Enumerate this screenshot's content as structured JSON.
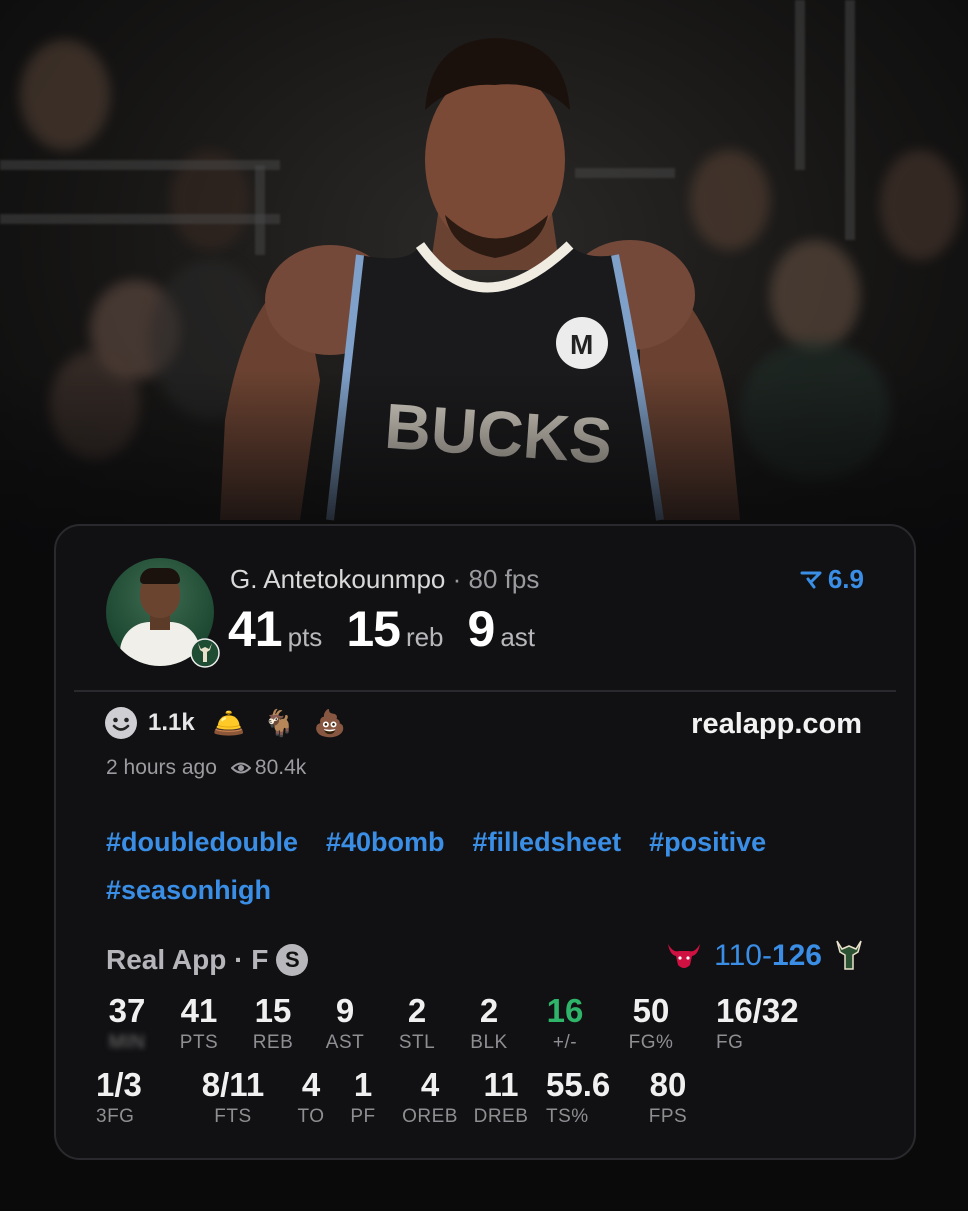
{
  "card": {
    "player_name": "G. Antetokounmpo",
    "fps_label": "80 fps",
    "pts": "41",
    "pts_unit": "pts",
    "reb": "15",
    "reb_unit": "reb",
    "ast": "9",
    "ast_unit": "ast",
    "rating": "6.9",
    "reaction_count": "1.1k",
    "reactions": [
      "🛎️",
      "🐐",
      "💩"
    ],
    "site": "realapp.com",
    "time_ago": "2 hours ago",
    "views": "80.4k",
    "hashtags": [
      "#doubledouble",
      "#40bomb",
      "#filledsheet",
      "#positive",
      "#seasonhigh"
    ],
    "source_label": "Real App · F",
    "source_badge": "S",
    "score_away": "110",
    "score_sep": "-",
    "score_home": "126"
  },
  "stats": [
    {
      "value": "37",
      "key": "MIN"
    },
    {
      "value": "41",
      "key": "PTS"
    },
    {
      "value": "15",
      "key": "REB"
    },
    {
      "value": "9",
      "key": "AST"
    },
    {
      "value": "2",
      "key": "STL"
    },
    {
      "value": "2",
      "key": "BLK"
    },
    {
      "value": "16",
      "key": "+/-"
    },
    {
      "value": "50",
      "key": "FG%"
    },
    {
      "value": "16/32",
      "key": "FG"
    },
    {
      "value": "1/3",
      "key": "3FG"
    },
    {
      "value": "8/11",
      "key": "FTS"
    },
    {
      "value": "4",
      "key": "TO"
    },
    {
      "value": "1",
      "key": "PF"
    },
    {
      "value": "4",
      "key": "OREB"
    },
    {
      "value": "11",
      "key": "DREB"
    },
    {
      "value": "55.6",
      "key": "TS%"
    },
    {
      "value": "80",
      "key": "FPS"
    }
  ],
  "colors": {
    "accent": "#3a8ee6",
    "positive": "#2fb56a",
    "card_bg": "#111113",
    "jersey": "#1a1a1c"
  },
  "icons": {
    "rating": "ticket-arrow-icon",
    "reaction": "smiley-face-icon",
    "views": "eye-icon",
    "away_team": "bulls-logo-icon",
    "home_team": "bucks-logo-icon"
  }
}
